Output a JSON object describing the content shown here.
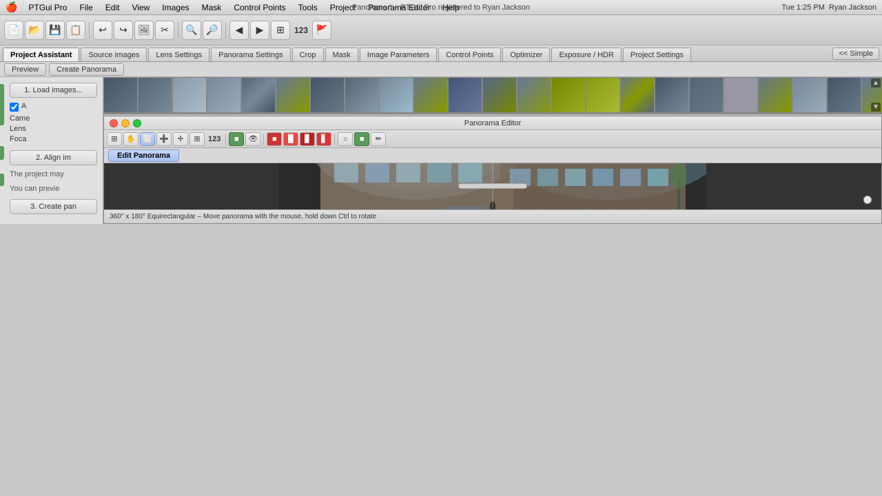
{
  "menubar": {
    "apple": "🍎",
    "app_name": "PTGui Pro",
    "menus": [
      "File",
      "Edit",
      "View",
      "Images",
      "Mask",
      "Control Points",
      "Tools",
      "Project",
      "Panorama Editor",
      "Help"
    ],
    "center_title": "Panorama * – PTGui Pro registered to Ryan Jackson",
    "right": {
      "time": "Tue 1:25 PM",
      "user": "Ryan Jackson"
    }
  },
  "toolbar": {
    "number": "123"
  },
  "tabs": {
    "items": [
      {
        "label": "Project Assistant",
        "active": true
      },
      {
        "label": "Source Images",
        "active": false
      },
      {
        "label": "Lens Settings",
        "active": false
      },
      {
        "label": "Panorama Settings",
        "active": false
      },
      {
        "label": "Crop",
        "active": false
      },
      {
        "label": "Mask",
        "active": false
      },
      {
        "label": "Image Parameters",
        "active": false
      },
      {
        "label": "Control Points",
        "active": false
      },
      {
        "label": "Optimizer",
        "active": false
      },
      {
        "label": "Exposure / HDR",
        "active": false
      },
      {
        "label": "Project Settings",
        "active": false
      }
    ],
    "simple_btn": "<< Simple"
  },
  "sub_tabs": [
    {
      "label": "Preview",
      "active": false
    },
    {
      "label": "Create Panorama",
      "active": false
    }
  ],
  "left_panel": {
    "load_btn": "1. Load images...",
    "camera_label": "Came",
    "lens_label": "Lens",
    "focal_label": "Foca",
    "align_btn": "2. Align im",
    "project_may_text": "The project may",
    "preview_text": "You can previe",
    "create_btn": "3. Create pan"
  },
  "pano_editor": {
    "title": "Panorama Editor",
    "toolbar_number": "123",
    "edit_pano_tab": "Edit Panorama",
    "status_bar": "360° x 180° Equirectangular – Move panorama with the mouse, hold down Ctrl to rotate"
  }
}
